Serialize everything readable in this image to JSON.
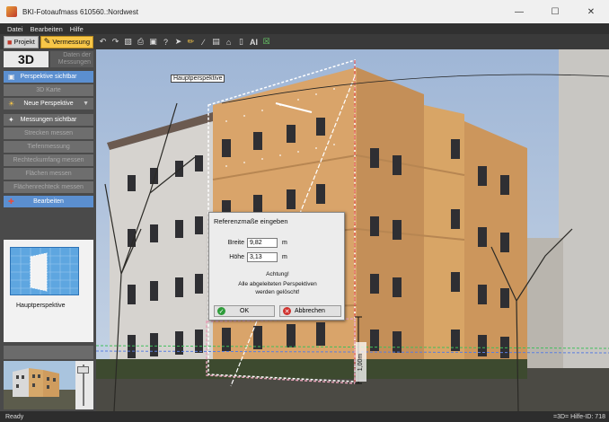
{
  "window": {
    "title": "BKI-Fotoaufmass 610560.:Nordwest",
    "minimize_icon": "minimize-icon",
    "maximize_icon": "maximize-icon",
    "close_icon": "close-icon"
  },
  "menu": [
    "Datei",
    "Bearbeiten",
    "Hilfe"
  ],
  "toolbar": {
    "projekt_label": "Projekt",
    "vermessung_label": "Vermessung",
    "ai_label": "AI"
  },
  "sidebar": {
    "mode_3d": "3D",
    "mode_daten": "Daten der Messungen",
    "items": [
      {
        "label": "Perspektive sichtbar",
        "state": "active"
      },
      {
        "label": "3D Karte",
        "state": "disabled"
      },
      {
        "label": "Neue Perspektive",
        "state": "plain"
      },
      {
        "label": "Messungen sichtbar",
        "state": "plain"
      },
      {
        "label": "Strecken messen",
        "state": "disabled"
      },
      {
        "label": "Tiefenmessung",
        "state": "disabled"
      },
      {
        "label": "Rechteckumfang messen",
        "state": "disabled"
      },
      {
        "label": "Flächen messen",
        "state": "disabled"
      },
      {
        "label": "Flächenrechteck messen",
        "state": "disabled"
      },
      {
        "label": "Bearbeiten",
        "state": "active"
      }
    ],
    "thumbnail_label": "Hauptperspektive"
  },
  "viewport": {
    "perspective_label": "Hauptperspektive",
    "measure_label": "1,00m"
  },
  "dialog": {
    "title": "Referenzmaße eingeben",
    "breite_label": "Breite",
    "breite_value": "9,82",
    "breite_unit": "m",
    "hoehe_label": "Höhe",
    "hoehe_value": "3,13",
    "hoehe_unit": "m",
    "warn_line1": "Achtung!",
    "warn_line2": "Alle abgeleiteten Perspektiven",
    "warn_line3": "werden gelöscht!",
    "ok_label": "OK",
    "cancel_label": "Abbrechen"
  },
  "status": {
    "left": "Ready",
    "right": "=3D=  Hilfe-ID: 718"
  }
}
